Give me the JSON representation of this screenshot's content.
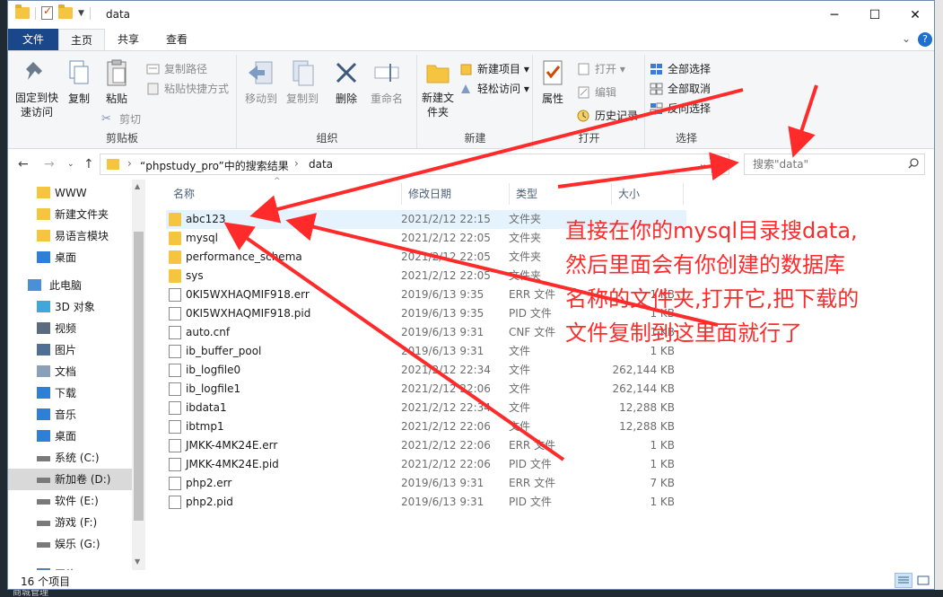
{
  "window": {
    "title": "data",
    "controls": {
      "minimize": "─",
      "maximize": "☐",
      "close": "✕"
    }
  },
  "ribbon_tabs": {
    "file": "文件",
    "home": "主页",
    "share": "共享",
    "view": "查看"
  },
  "ribbon": {
    "clipboard": {
      "title": "剪贴板",
      "pin": "固定到快速访问",
      "copy": "复制",
      "paste": "粘贴",
      "copy_path": "复制路径",
      "paste_shortcut": "粘贴快捷方式",
      "cut": "剪切"
    },
    "organize": {
      "title": "组织",
      "move_to": "移动到",
      "copy_to": "复制到",
      "delete": "删除",
      "rename": "重命名"
    },
    "new": {
      "title": "新建",
      "new_folder": "新建文件夹",
      "new_item": "新建项目 ▾",
      "easy_access": "轻松访问 ▾"
    },
    "open": {
      "title": "打开",
      "properties": "属性",
      "open": "打开 ▾",
      "edit": "编辑",
      "history": "历史记录"
    },
    "select": {
      "title": "选择",
      "select_all": "全部选择",
      "select_none": "全部取消",
      "invert": "反向选择"
    }
  },
  "address": {
    "crumbs": [
      "“phpstudy_pro”中的搜索结果",
      "data"
    ]
  },
  "search": {
    "placeholder": "搜索\"data\""
  },
  "nav_pane": {
    "items": [
      {
        "label": "WWW",
        "icon": "folder-icon"
      },
      {
        "label": "新建文件夹",
        "icon": "folder-icon"
      },
      {
        "label": "易语言模块",
        "icon": "folder-icon"
      },
      {
        "label": "桌面",
        "icon": "desktop-icon"
      },
      {
        "label": "此电脑",
        "icon": "pc-icon"
      },
      {
        "label": "3D 对象",
        "icon": "cube-icon"
      },
      {
        "label": "视频",
        "icon": "video-icon"
      },
      {
        "label": "图片",
        "icon": "picture-icon"
      },
      {
        "label": "文档",
        "icon": "document-icon"
      },
      {
        "label": "下载",
        "icon": "download-icon"
      },
      {
        "label": "音乐",
        "icon": "music-icon"
      },
      {
        "label": "桌面",
        "icon": "desktop-icon"
      },
      {
        "label": "系统 (C:)",
        "icon": "drive-icon"
      },
      {
        "label": "新加卷 (D:)",
        "icon": "drive-icon"
      },
      {
        "label": "软件 (E:)",
        "icon": "drive-icon"
      },
      {
        "label": "游戏 (F:)",
        "icon": "drive-icon"
      },
      {
        "label": "娱乐 (G:)",
        "icon": "drive-icon"
      },
      {
        "label": "网络",
        "icon": "network-icon"
      }
    ]
  },
  "columns": {
    "name": "名称",
    "date": "修改日期",
    "type": "类型",
    "size": "大小"
  },
  "files": [
    {
      "name": "abc123",
      "date": "2021/2/12 22:15",
      "type": "文件夹",
      "size": "",
      "kind": "folder"
    },
    {
      "name": "mysql",
      "date": "2021/2/12 22:05",
      "type": "文件夹",
      "size": "",
      "kind": "folder"
    },
    {
      "name": "performance_schema",
      "date": "2021/2/12 22:05",
      "type": "文件夹",
      "size": "",
      "kind": "folder"
    },
    {
      "name": "sys",
      "date": "2021/2/12 22:05",
      "type": "文件夹",
      "size": "",
      "kind": "folder"
    },
    {
      "name": "0KI5WXHAQMIF918.err",
      "date": "2019/6/13 9:35",
      "type": "ERR 文件",
      "size": "1 KB",
      "kind": "file"
    },
    {
      "name": "0KI5WXHAQMIF918.pid",
      "date": "2019/6/13 9:35",
      "type": "PID 文件",
      "size": "1 KB",
      "kind": "file"
    },
    {
      "name": "auto.cnf",
      "date": "2019/6/13 9:31",
      "type": "CNF 文件",
      "size": "1 KB",
      "kind": "file"
    },
    {
      "name": "ib_buffer_pool",
      "date": "2019/6/13 9:31",
      "type": "文件",
      "size": "1 KB",
      "kind": "file"
    },
    {
      "name": "ib_logfile0",
      "date": "2021/2/12 22:34",
      "type": "文件",
      "size": "262,144 KB",
      "kind": "file"
    },
    {
      "name": "ib_logfile1",
      "date": "2021/2/12 22:06",
      "type": "文件",
      "size": "262,144 KB",
      "kind": "file"
    },
    {
      "name": "ibdata1",
      "date": "2021/2/12 22:34",
      "type": "文件",
      "size": "12,288 KB",
      "kind": "file"
    },
    {
      "name": "ibtmp1",
      "date": "2021/2/12 22:06",
      "type": "文件",
      "size": "12,288 KB",
      "kind": "file"
    },
    {
      "name": "JMKK-4MK24E.err",
      "date": "2021/2/12 22:06",
      "type": "ERR 文件",
      "size": "1 KB",
      "kind": "file"
    },
    {
      "name": "JMKK-4MK24E.pid",
      "date": "2021/2/12 22:06",
      "type": "PID 文件",
      "size": "1 KB",
      "kind": "file"
    },
    {
      "name": "php2.err",
      "date": "2019/6/13 9:31",
      "type": "ERR 文件",
      "size": "7 KB",
      "kind": "file"
    },
    {
      "name": "php2.pid",
      "date": "2019/6/13 9:31",
      "type": "PID 文件",
      "size": "1 KB",
      "kind": "file"
    }
  ],
  "status": {
    "count": "16 个项目"
  },
  "annotation": {
    "lines": [
      "直接在你的mysql目录搜data,",
      "然后里面会有你创建的数据库",
      "名称的文件夹,打开它,把下载的",
      "文件复制到这里面就行了"
    ],
    "color": "#ff2a2a"
  },
  "taskbar_fragment": "商城管理",
  "accent_color": "#19478a"
}
